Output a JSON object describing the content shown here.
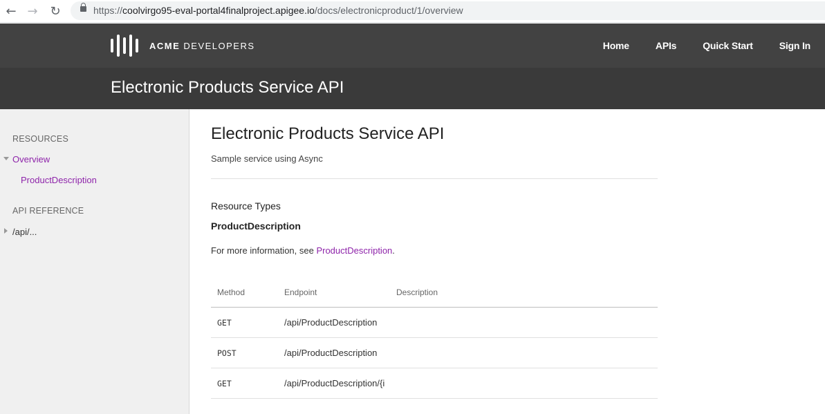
{
  "browser": {
    "url_prefix": "https://",
    "url_host": "coolvirgo95-eval-portal4finalproject.apigee.io",
    "url_path": "/docs/electronicproduct/1/overview",
    "back_icon": "arrow-left-icon",
    "forward_icon": "arrow-right-icon",
    "reload_icon": "reload-icon",
    "lock_icon": "lock-icon"
  },
  "header": {
    "logo_icon": "sound-bars-logo",
    "brand_bold": "ACME",
    "brand_rest": " DEVELOPERS",
    "nav": [
      {
        "label": "Home"
      },
      {
        "label": "APIs"
      },
      {
        "label": "Quick Start"
      },
      {
        "label": "Sign In"
      }
    ],
    "bg_color": "#424242"
  },
  "title_band": {
    "title": "Electronic Products Service API",
    "bg_color": "#3a3a3a"
  },
  "sidebar": {
    "resources_heading": "RESOURCES",
    "overview_label": "Overview",
    "product_description_label": "ProductDescription",
    "api_reference_heading": "API REFERENCE",
    "api_path_label": "/api/...",
    "link_color": "#8e24aa"
  },
  "main": {
    "title": "Electronic Products Service API",
    "subtitle": "Sample service using Async",
    "resource_types_label": "Resource Types",
    "resource_name": "ProductDescription",
    "more_info_prefix": "For more information, see ",
    "more_info_link": "ProductDescription",
    "more_info_suffix": ".",
    "table": {
      "headers": {
        "method": "Method",
        "endpoint": "Endpoint",
        "description": "Description"
      },
      "rows": [
        {
          "method": "GET",
          "endpoint": "/api/ProductDescription",
          "description": ""
        },
        {
          "method": "POST",
          "endpoint": "/api/ProductDescription",
          "description": ""
        },
        {
          "method": "GET",
          "endpoint": "/api/ProductDescription/{i",
          "description": ""
        }
      ]
    }
  }
}
